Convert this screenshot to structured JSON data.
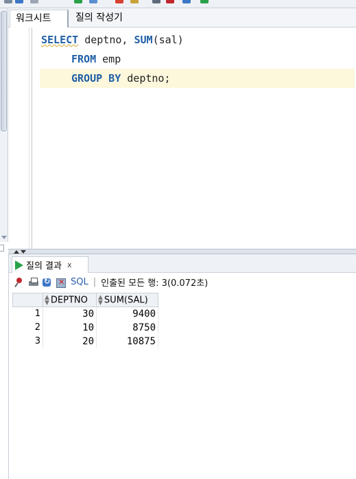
{
  "worksheet_tabs": {
    "tab1": "워크시트",
    "tab2": "질의 작성기"
  },
  "editor": {
    "lines": [
      {
        "kw1": "SELECT",
        "t1": " deptno, ",
        "kw2": "SUM",
        "t2": "(sal)"
      },
      {
        "kw1": "FROM",
        "t1": " emp"
      },
      {
        "kw1": "GROUP BY",
        "t1": " deptno;"
      }
    ]
  },
  "results": {
    "tab_label": "질의 결과",
    "close_label": "x",
    "sql_label": "SQL",
    "separator": "|",
    "status": "인출된 모든 행: 3(0.072초)",
    "columns": [
      "DEPTNO",
      "SUM(SAL)"
    ],
    "rows": [
      {
        "n": "1",
        "c1": "30",
        "c2": "9400"
      },
      {
        "n": "2",
        "c1": "10",
        "c2": "8750"
      },
      {
        "n": "3",
        "c1": "20",
        "c2": "10875"
      }
    ]
  },
  "icons": {
    "result_tab": "run-play-icon",
    "toolbar": [
      "pin-icon",
      "print-icon",
      "refresh-icon",
      "delete-icon"
    ]
  },
  "colors": {
    "keyword": "#1f5fa6",
    "current_line": "#fdf7dc",
    "link": "#2a5db0"
  }
}
